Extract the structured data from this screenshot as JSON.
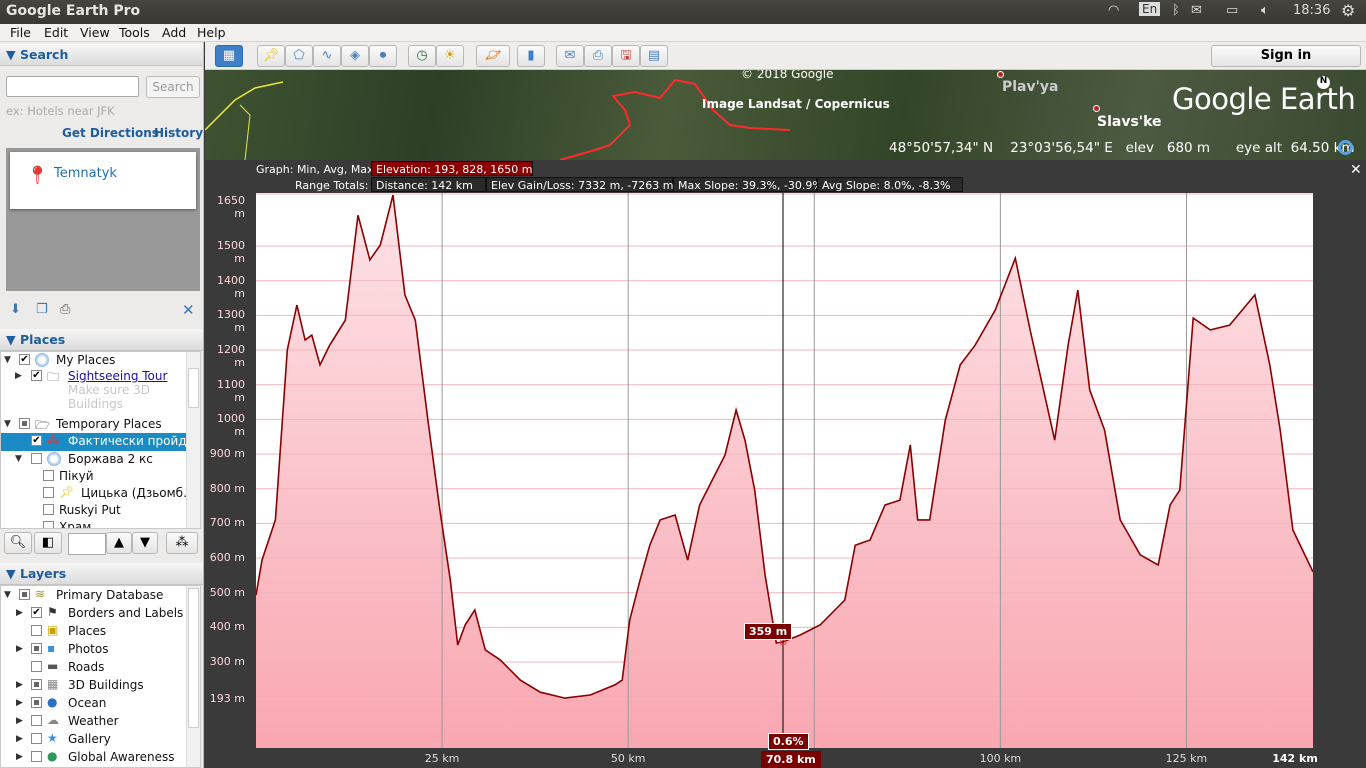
{
  "system_bar": {
    "app_title": "Google Earth Pro",
    "lang": "En",
    "time": "18:36",
    "icons": [
      "wifi-icon",
      "keyboard-lang-icon",
      "bluetooth-icon",
      "mail-icon",
      "battery-icon",
      "volume-icon",
      "settings-gear-icon"
    ]
  },
  "menu": [
    "File",
    "Edit",
    "View",
    "Tools",
    "Add",
    "Help"
  ],
  "search": {
    "header": "Search",
    "input_value": "",
    "button": "Search",
    "hint": "ex: Hotels near JFK",
    "get_directions": "Get Directions",
    "history": "History",
    "result": "Temnatyk"
  },
  "places": {
    "header": "Places",
    "items": [
      {
        "label": "My Places",
        "checked": true
      },
      {
        "label": "Sightseeing Tour",
        "checked": true,
        "link": true
      },
      {
        "label": "Make sure 3D Buildings",
        "note": true
      },
      {
        "label": "Temporary Places",
        "checked": "partial"
      },
      {
        "label": "Фактически пройд…",
        "checked": true,
        "selected": true
      },
      {
        "label": "Боржава 2 кс",
        "checked": false
      },
      {
        "label": "Пікуй",
        "checked": false
      },
      {
        "label": "Цицька (Дзьомб…",
        "checked": false
      },
      {
        "label": "Ruskyi Put",
        "checked": false
      },
      {
        "label": "Храм",
        "checked": false
      }
    ]
  },
  "layers": {
    "header": "Layers",
    "items": [
      {
        "label": "Primary Database",
        "checked": "partial"
      },
      {
        "label": "Borders and Labels",
        "checked": true
      },
      {
        "label": "Places",
        "checked": false
      },
      {
        "label": "Photos",
        "checked": "partial"
      },
      {
        "label": "Roads",
        "checked": false
      },
      {
        "label": "3D Buildings",
        "checked": "partial"
      },
      {
        "label": "Ocean",
        "checked": "partial"
      },
      {
        "label": "Weather",
        "checked": false
      },
      {
        "label": "Gallery",
        "checked": false
      },
      {
        "label": "Global Awareness",
        "checked": false
      }
    ]
  },
  "toolbar": {
    "sign_in": "Sign in",
    "buttons": [
      "sidebar-toggle",
      "add-placemark",
      "add-polygon",
      "add-path",
      "add-image-overlay",
      "record-tour",
      "historical-imagery",
      "sunlight",
      "switch-planet",
      "ruler",
      "email",
      "print",
      "save-image",
      "view-in-maps"
    ]
  },
  "map": {
    "copyright": "© 2018 Google",
    "imagery": "Image Landsat / Copernicus",
    "labels": [
      "Plav'ya",
      "Slavs'ke"
    ],
    "logo": "Google Earth",
    "lat": "48°50'57,34\" N",
    "lon": "23°03'56,54\" E",
    "elev_label": "elev",
    "elev": "680 m",
    "eye_alt_label": "eye alt",
    "eye_alt": "64.50 km"
  },
  "graph": {
    "graph_label": "Graph: Min, Avg, Max",
    "elevation": "Elevation: 193, 828, 1650 m",
    "range_label": "Range Totals:",
    "distance": "Distance: 142 km",
    "gain_loss": "Elev Gain/Loss: 7332 m, -7263 m",
    "max_slope": "Max Slope: 39.3%, -30.9%",
    "avg_slope": "Avg Slope: 8.0%, -8.3%",
    "cursor_elev": "359 m",
    "cursor_slope": "0.6%",
    "cursor_dist": "70.8 km",
    "colors": {
      "line": "#8b0000",
      "fill_top": "#fde3e7",
      "fill_bottom": "#f9a7b1"
    }
  },
  "chart_data": {
    "type": "area",
    "x_unit": "km",
    "y_unit": "m",
    "xlim": [
      0,
      142
    ],
    "ylim": [
      52,
      1653
    ],
    "y_ticks": [
      {
        "v": 1650,
        "label": "1650 m"
      },
      {
        "v": 1500,
        "label": "1500 m"
      },
      {
        "v": 1400,
        "label": "1400 m"
      },
      {
        "v": 1300,
        "label": "1300 m"
      },
      {
        "v": 1200,
        "label": "1200 m"
      },
      {
        "v": 1100,
        "label": "1100 m"
      },
      {
        "v": 1000,
        "label": "1000 m"
      },
      {
        "v": 900,
        "label": "900 m"
      },
      {
        "v": 800,
        "label": "800 m"
      },
      {
        "v": 700,
        "label": "700 m"
      },
      {
        "v": 600,
        "label": "600 m"
      },
      {
        "v": 500,
        "label": "500 m"
      },
      {
        "v": 400,
        "label": "400 m"
      },
      {
        "v": 300,
        "label": "300 m"
      },
      {
        "v": 193,
        "label": "193 m"
      }
    ],
    "x_ticks": [
      {
        "v": 25,
        "label": "25 km"
      },
      {
        "v": 50,
        "label": "50 km"
      },
      {
        "v": 75,
        "label": ""
      },
      {
        "v": 100,
        "label": "100 km"
      },
      {
        "v": 125,
        "label": "125 km"
      },
      {
        "v": 142,
        "label": "142 km"
      }
    ],
    "cursor_km": 70.8,
    "points": [
      [
        0,
        493
      ],
      [
        0.8,
        594
      ],
      [
        2.6,
        710
      ],
      [
        4.2,
        1200
      ],
      [
        5.5,
        1330
      ],
      [
        6.6,
        1229
      ],
      [
        7.5,
        1243
      ],
      [
        8.6,
        1157
      ],
      [
        9.9,
        1214
      ],
      [
        12,
        1286
      ],
      [
        13.7,
        1589
      ],
      [
        15.3,
        1460
      ],
      [
        16.7,
        1503
      ],
      [
        18.4,
        1647
      ],
      [
        20,
        1359
      ],
      [
        21.4,
        1286
      ],
      [
        23.1,
        998
      ],
      [
        24.7,
        738
      ],
      [
        26.1,
        537
      ],
      [
        27.1,
        349
      ],
      [
        28.1,
        407
      ],
      [
        29.4,
        450
      ],
      [
        30.8,
        335
      ],
      [
        32.8,
        306
      ],
      [
        35.5,
        248
      ],
      [
        38.2,
        213
      ],
      [
        41.5,
        196
      ],
      [
        44.9,
        205
      ],
      [
        48.2,
        234
      ],
      [
        49.2,
        248
      ],
      [
        50.2,
        421
      ],
      [
        51.6,
        537
      ],
      [
        52.9,
        637
      ],
      [
        54.3,
        710
      ],
      [
        56.3,
        724
      ],
      [
        58,
        594
      ],
      [
        59.6,
        753
      ],
      [
        61.3,
        825
      ],
      [
        63,
        897
      ],
      [
        64.5,
        1027
      ],
      [
        65.7,
        940
      ],
      [
        67,
        796
      ],
      [
        68.4,
        551
      ],
      [
        69.9,
        355
      ],
      [
        70.8,
        358
      ],
      [
        73.1,
        378
      ],
      [
        75.8,
        407
      ],
      [
        79.1,
        479
      ],
      [
        80.5,
        637
      ],
      [
        82.5,
        652
      ],
      [
        84.5,
        753
      ],
      [
        86.5,
        767
      ],
      [
        87.9,
        926
      ],
      [
        88.9,
        710
      ],
      [
        90.5,
        710
      ],
      [
        92.6,
        998
      ],
      [
        94.6,
        1157
      ],
      [
        96.6,
        1214
      ],
      [
        99.3,
        1315
      ],
      [
        102,
        1465
      ],
      [
        104,
        1258
      ],
      [
        107.3,
        940
      ],
      [
        109.1,
        1214
      ],
      [
        110.4,
        1373
      ],
      [
        112,
        1085
      ],
      [
        114,
        969
      ],
      [
        116.1,
        710
      ],
      [
        118.8,
        609
      ],
      [
        121.2,
        580
      ],
      [
        122.8,
        753
      ],
      [
        124.1,
        796
      ],
      [
        125.9,
        1292
      ],
      [
        128.2,
        1258
      ],
      [
        130.8,
        1272
      ],
      [
        134.2,
        1359
      ],
      [
        136.2,
        1157
      ],
      [
        137.6,
        969
      ],
      [
        139.3,
        681
      ],
      [
        142,
        560
      ]
    ]
  }
}
